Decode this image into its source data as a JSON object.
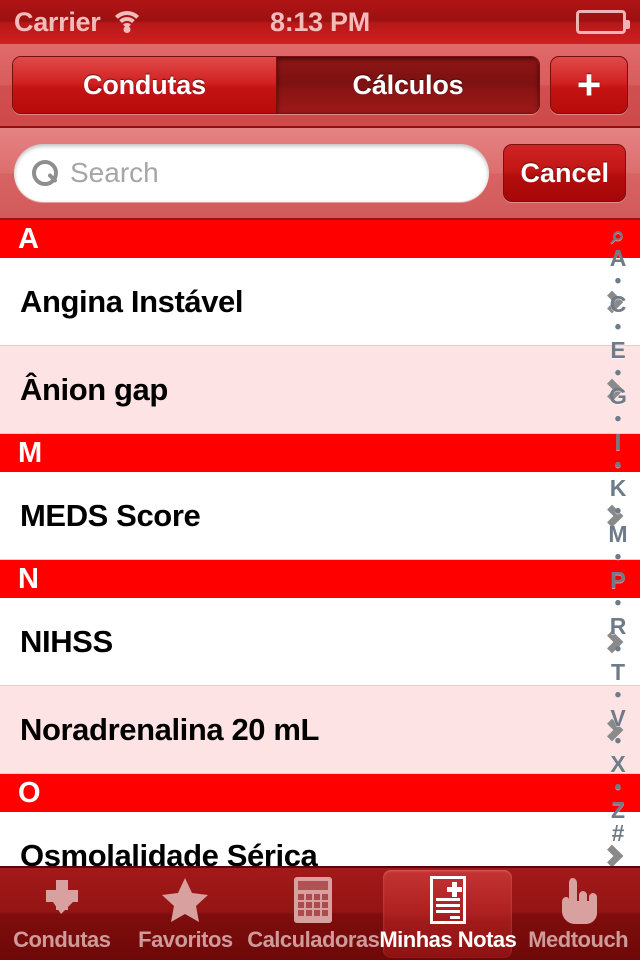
{
  "status_bar": {
    "carrier": "Carrier",
    "wifi_icon": "wifi-icon",
    "time": "8:13 PM",
    "battery_icon": "battery-icon"
  },
  "nav_bar": {
    "segments": [
      {
        "label": "Condutas",
        "selected": false
      },
      {
        "label": "Cálculos",
        "selected": true
      }
    ],
    "add_button": {
      "label": "+",
      "icon": "plus-icon"
    }
  },
  "search": {
    "icon": "search-icon",
    "placeholder": "Search",
    "value": "",
    "cancel_label": "Cancel"
  },
  "list": {
    "sections": [
      {
        "letter": "A",
        "rows": [
          {
            "title": "Angina Instável",
            "shade": "white"
          },
          {
            "title": "Ânion gap",
            "shade": "pink"
          }
        ]
      },
      {
        "letter": "M",
        "rows": [
          {
            "title": "MEDS Score",
            "shade": "white"
          }
        ]
      },
      {
        "letter": "N",
        "rows": [
          {
            "title": "NIHSS",
            "shade": "white"
          },
          {
            "title": "Noradrenalina 20 mL",
            "shade": "pink"
          }
        ]
      },
      {
        "letter": "O",
        "rows": [
          {
            "title": "Osmolalidade Sérica",
            "shade": "white"
          }
        ]
      }
    ],
    "disclosure_icon": "chevron-right-icon"
  },
  "index_bar": {
    "entries": [
      "⌕",
      "A",
      "•",
      "C",
      "•",
      "E",
      "•",
      "G",
      "•",
      "I",
      "•",
      "K",
      "•",
      "M",
      "•",
      "P",
      "•",
      "R",
      "•",
      "T",
      "•",
      "V",
      "•",
      "X",
      "•",
      "Z",
      "#"
    ]
  },
  "tab_bar": {
    "tabs": [
      {
        "label": "Condutas",
        "icon": "cross-check-icon",
        "selected": false
      },
      {
        "label": "Favoritos",
        "icon": "star-icon",
        "selected": false
      },
      {
        "label": "Calculadoras",
        "icon": "calculator-icon",
        "selected": false
      },
      {
        "label": "Minhas Notas",
        "icon": "note-plus-icon",
        "selected": true
      },
      {
        "label": "Medtouch",
        "icon": "pointing-hand-icon",
        "selected": false
      }
    ]
  },
  "colors": {
    "section_header_bg": "#FF0000",
    "row_alt_bg": "#FDE3E3",
    "tabbar_bg": "#941414",
    "accent_red": "#C41313"
  }
}
